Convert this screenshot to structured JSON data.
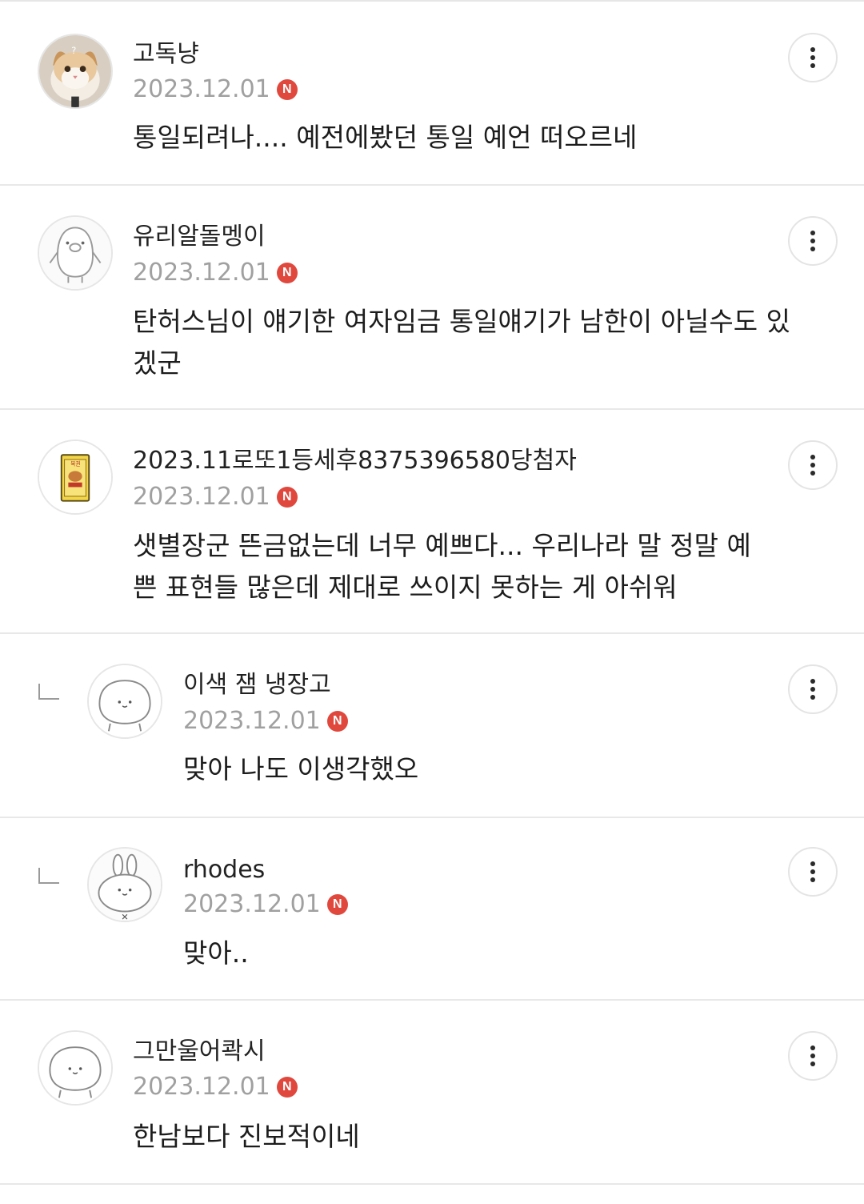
{
  "comments": [
    {
      "nickname": "고독냥",
      "date": "2023.12.01",
      "badge": "N",
      "text": "통일되려나.... 예전에봤던 통일 예언 떠오르네",
      "avatar": "cat-photo-avatar",
      "reply": false
    },
    {
      "nickname": "유리알돌멩이",
      "date": "2023.12.01",
      "badge": "N",
      "text": "탄허스님이 얘기한 여자임금 통일얘기가 남한이 아닐수도 있겠군",
      "avatar": "penguin-avatar",
      "reply": false
    },
    {
      "nickname": "2023.11로또1등세후8375396580당첨자",
      "date": "2023.12.01",
      "badge": "N",
      "text": "샛별장군 뜬금없는데 너무 예쁘다... 우리나라 말 정말 예쁜 표현들 많은데 제대로 쓰이지 못하는 게 아쉬워",
      "avatar": "lottery-ticket-avatar",
      "reply": false
    },
    {
      "nickname": "이색 잼 냉장고",
      "date": "2023.12.01",
      "badge": "N",
      "text": "맞아 나도 이생각했오",
      "avatar": "blob-avatar",
      "reply": true
    },
    {
      "nickname": "rhodes",
      "date": "2023.12.01",
      "badge": "N",
      "text": "맞아..",
      "avatar": "bunny-avatar",
      "reply": true
    },
    {
      "nickname": "그만울어콱시",
      "date": "2023.12.01",
      "badge": "N",
      "text": "한남보다 진보적이네",
      "avatar": "blob-avatar",
      "reply": false
    }
  ],
  "colors": {
    "badge": "#e0483d",
    "date": "#a0a0a0",
    "divider": "#e8e8e8"
  },
  "icons": {
    "more": "vertical-ellipsis-icon",
    "reply": "reply-corner-icon"
  }
}
